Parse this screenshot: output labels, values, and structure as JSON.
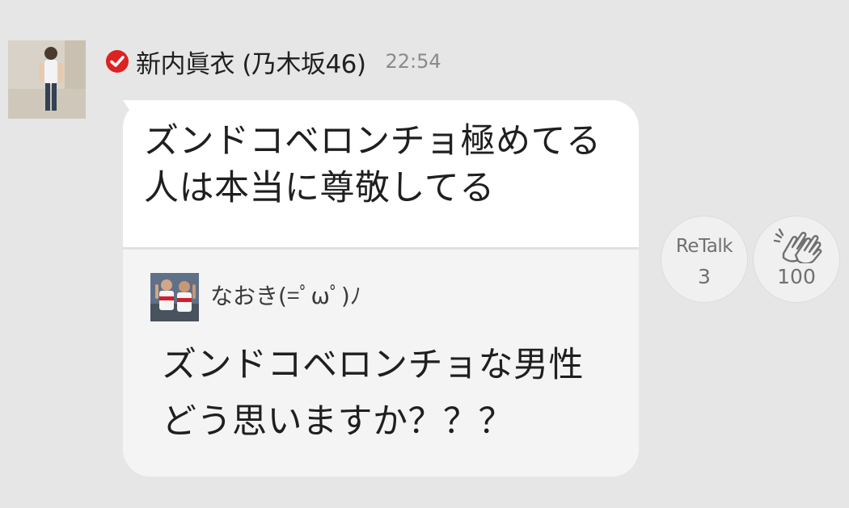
{
  "post": {
    "author": "新内眞衣 (乃木坂46)",
    "time": "22:54",
    "message": "ズンドコベロンチョ極めてる人は本当に尊敬してる",
    "avatar_icon": "person-avatar-icon",
    "verified_icon": "verified-check-icon",
    "verified_color": "#dd2222"
  },
  "quote": {
    "author": "なおき(=ﾟωﾟ)ﾉ",
    "message": "ズンドコベロンチョな男性どう思いますか？？？",
    "avatar_icon": "soccer-players-avatar-icon"
  },
  "actions": {
    "retalk_label": "ReTalk",
    "retalk_count": "3",
    "clap_icon": "clapping-hands-icon",
    "clap_count": "100"
  },
  "colors": {
    "background": "#e6e6e6",
    "bubble": "#ffffff",
    "quote_bg": "#f4f4f4",
    "muted_text": "#8a8a8a"
  }
}
